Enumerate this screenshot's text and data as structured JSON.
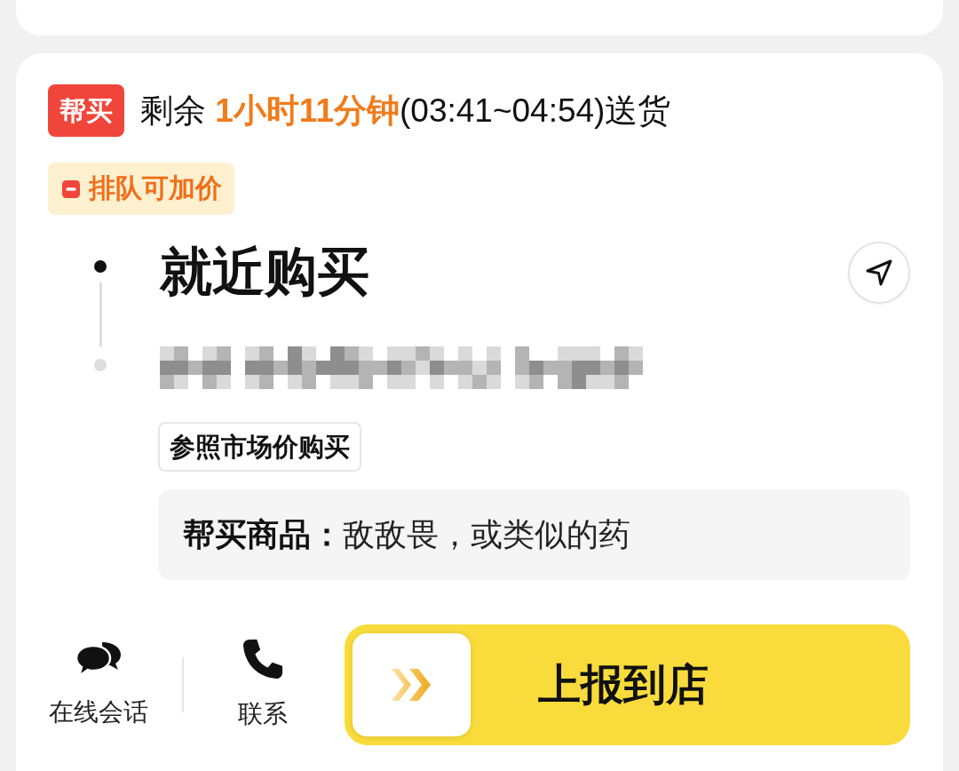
{
  "order": {
    "badge": "帮买",
    "time_text": "剩余 **1小时11分钟**(03:41~04:54)送货",
    "tag": "排队可加价",
    "title": "就近购买",
    "price_tag": "参照市场价购买",
    "goods": "**帮买商品：**敌敌畏，或类似的药"
  },
  "actions": [
    {
      "kind": "chat",
      "label": "在线会话"
    },
    {
      "kind": "phone",
      "label": "联系"
    }
  ],
  "report_button": {
    "label": "上报到店"
  }
}
